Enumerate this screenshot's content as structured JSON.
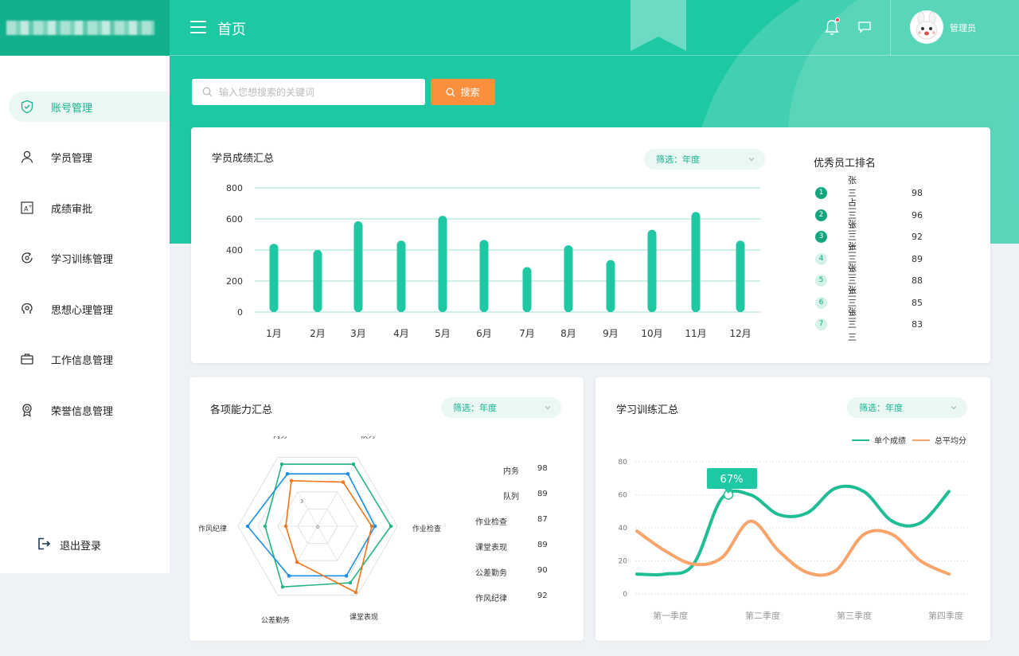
{
  "header": {
    "title": "首页",
    "admin": "管理员"
  },
  "sidebar": {
    "items": [
      {
        "label": "账号管理",
        "icon": "shield-icon",
        "active": true
      },
      {
        "label": "学员管理",
        "icon": "user-icon"
      },
      {
        "label": "成绩审批",
        "icon": "grade-icon"
      },
      {
        "label": "学习训练管理",
        "icon": "cycle-icon"
      },
      {
        "label": "思想心理管理",
        "icon": "brain-icon"
      },
      {
        "label": "工作信息管理",
        "icon": "briefcase-icon"
      },
      {
        "label": "荣誉信息管理",
        "icon": "medal-icon"
      }
    ],
    "logout": "退出登录"
  },
  "search": {
    "placeholder": "输入您想搜索的关键词",
    "button": "搜索"
  },
  "score_card": {
    "title": "学员成绩汇总",
    "filter": "筛选：年度"
  },
  "rank": {
    "title": "优秀员工排名",
    "rows": [
      {
        "num": "1",
        "name": "张三三",
        "score": "98"
      },
      {
        "num": "2",
        "name": "占三三",
        "score": "96"
      },
      {
        "num": "3",
        "name": "张三三",
        "score": "92"
      },
      {
        "num": "4",
        "name": "张三三",
        "score": "89"
      },
      {
        "num": "5",
        "name": "张三三",
        "score": "88"
      },
      {
        "num": "6",
        "name": "张三三",
        "score": "85"
      },
      {
        "num": "7",
        "name": "张三三",
        "score": "83"
      }
    ]
  },
  "ability_card": {
    "title": "各项能力汇总",
    "filter": "筛选：年度",
    "list": [
      {
        "name": "内务",
        "value": "98"
      },
      {
        "name": "队列",
        "value": "89"
      },
      {
        "name": "作业检查",
        "value": "87"
      },
      {
        "name": "课堂表现",
        "value": "89"
      },
      {
        "name": "公差勤务",
        "value": "90"
      },
      {
        "name": "作风纪律",
        "value": "92"
      }
    ]
  },
  "training_card": {
    "title": "学习训练汇总",
    "filter": "筛选：年度",
    "tooltip": "67%"
  },
  "colors": {
    "primary": "#1ec8a3",
    "orange": "#fa8f3d",
    "blue": "#1b8fe6"
  },
  "chart_data": [
    {
      "type": "bar",
      "categories": [
        "1月",
        "2月",
        "3月",
        "4月",
        "5月",
        "6月",
        "7月",
        "8月",
        "9月",
        "10月",
        "11月",
        "12月"
      ],
      "values": [
        440,
        400,
        585,
        460,
        620,
        465,
        290,
        430,
        335,
        530,
        645,
        460
      ],
      "ylim": [
        0,
        800
      ],
      "yticks": [
        "0",
        "200",
        "400",
        "600",
        "800"
      ]
    },
    {
      "type": "radar",
      "axes": [
        "内务",
        "队列",
        "作业检查",
        "课堂表现",
        "公差勤务",
        "作风纪律"
      ],
      "rmax": 5,
      "ring_labels": [
        "0",
        "3"
      ],
      "series": [
        {
          "color": "#22b57e",
          "values": [
            4.5,
            4.5,
            4.6,
            4.1,
            4.4,
            3.3
          ]
        },
        {
          "color": "#1b8fe6",
          "values": [
            3.8,
            3.8,
            3.6,
            3.6,
            3.6,
            4.4
          ]
        },
        {
          "color": "#f2741b",
          "values": [
            3.3,
            3.2,
            3.4,
            4.8,
            2.6,
            2.0
          ]
        }
      ]
    },
    {
      "type": "line",
      "categories": [
        "第一季度",
        "第二季度",
        "第三季度",
        "第四季度"
      ],
      "ylim": [
        0,
        80
      ],
      "yticks": [
        "0",
        "20",
        "40",
        "60",
        "80"
      ],
      "series": [
        {
          "name": "单个成绩",
          "color": "#1fbd93",
          "values": [
            12,
            12,
            18,
            58,
            60,
            48,
            49,
            64,
            62,
            44,
            43,
            62
          ]
        },
        {
          "name": "总平均分",
          "color": "#f8a46a",
          "values": [
            38,
            26,
            18,
            22,
            44,
            26,
            13,
            14,
            36,
            36,
            20,
            12
          ]
        }
      ]
    }
  ]
}
